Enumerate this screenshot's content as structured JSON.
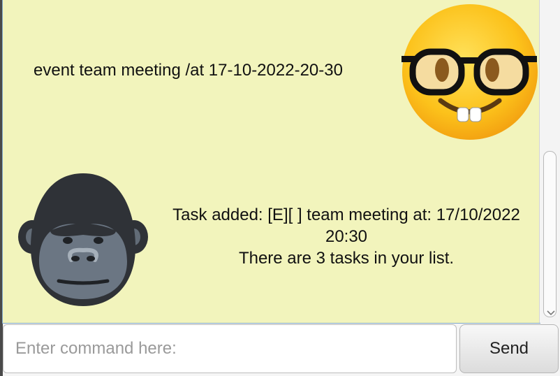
{
  "dialog": {
    "user_message": "event team meeting /at 17-10-2022-20-30",
    "bot_response": {
      "line1": "Task added: [E][ ] team meeting at: 17/10/2022",
      "line2": "20:30",
      "line3": "There are 3 tasks in your list."
    },
    "user_avatar_icon": "nerd-face-icon",
    "bot_avatar_icon": "gorilla-icon"
  },
  "input": {
    "placeholder": "Enter command here:",
    "value": ""
  },
  "send": {
    "label": "Send"
  },
  "colors": {
    "chat_background": "#f2f4bc",
    "chat_border": "#7fa7c9"
  }
}
